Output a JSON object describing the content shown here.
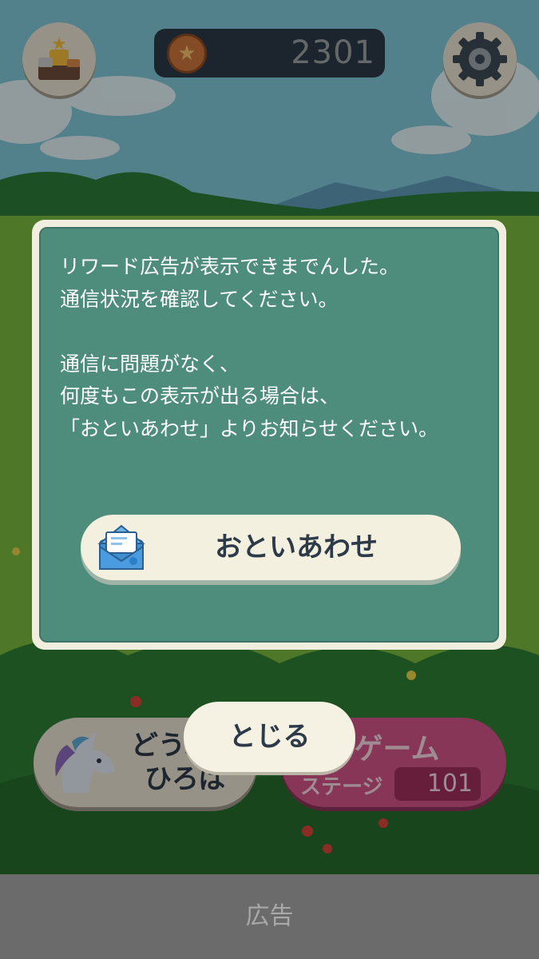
{
  "header": {
    "coin_count": "2301",
    "icons": [
      "trophy-icon",
      "coin-icon",
      "gear-icon"
    ]
  },
  "dialog": {
    "message": "リワード広告が表示できまでんした。\n通信状況を確認してください。\n\n通信に問題がなく、\n何度もこの表示が出る場合は、\n「おといあわせ」よりお知らせください。",
    "contact_label": "おといあわせ"
  },
  "close_label": "とじる",
  "menu": {
    "zoo_label": "どうぶつ\nひろば",
    "game_label": "ゲーム",
    "stage_label": "ステージ",
    "stage_number": "101"
  },
  "ad_label": "広告",
  "colors": {
    "dialog_frame": "#f2eedf",
    "dialog_fill": "#4e8d7b",
    "button_fill": "#f4f0e0",
    "game_button": "#d15486"
  }
}
